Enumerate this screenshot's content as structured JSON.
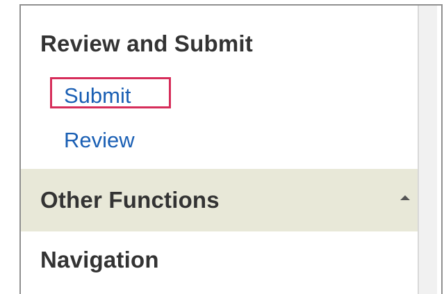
{
  "menu": {
    "review_and_submit": {
      "title": "Review and Submit",
      "links": [
        "Submit",
        "Review"
      ]
    },
    "other_functions": {
      "title": "Other Functions",
      "icon": "collapse-up-icon"
    },
    "navigation": {
      "title": "Navigation"
    }
  },
  "colors": {
    "link": "#1a5fb4",
    "highlight": "#d62d5a",
    "section_bar": "#e8e8d8"
  }
}
